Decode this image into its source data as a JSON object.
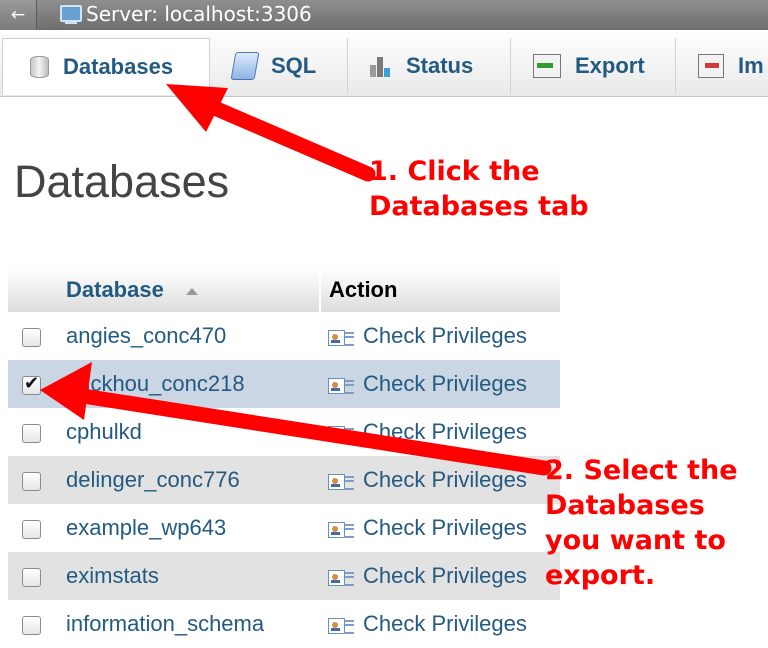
{
  "topbar": {
    "back_glyph": "←",
    "title": "Server: localhost:3306"
  },
  "tabs": [
    {
      "label": "Databases",
      "icon": "database-icon",
      "active": true
    },
    {
      "label": "SQL",
      "icon": "sql-icon"
    },
    {
      "label": "Status",
      "icon": "status-chart-icon"
    },
    {
      "label": "Export",
      "icon": "export-icon"
    },
    {
      "label": "Im",
      "icon": "import-icon"
    }
  ],
  "page": {
    "title": "Databases"
  },
  "table": {
    "headers": {
      "database": "Database",
      "action": "Action"
    },
    "action_label": "Check Privileges",
    "rows": [
      {
        "name": "angies_conc470",
        "checked": false
      },
      {
        "name": "brickhou_conc218",
        "checked": true
      },
      {
        "name": "cphulkd",
        "checked": false
      },
      {
        "name": "delinger_conc776",
        "checked": false
      },
      {
        "name": "example_wp643",
        "checked": false
      },
      {
        "name": "eximstats",
        "checked": false
      },
      {
        "name": "information_schema",
        "checked": false
      }
    ]
  },
  "annotations": {
    "step1_line1": "1. Click the",
    "step1_line2": "Databases tab",
    "step2_line1": "2. Select the",
    "step2_line2": "Databases",
    "step2_line3": "you want to",
    "step2_line4": "export."
  },
  "colors": {
    "link_blue": "#235a81",
    "annotation_red": "#ff0000",
    "row_marked": "#cad6e4",
    "row_even": "#e2e2e2"
  }
}
